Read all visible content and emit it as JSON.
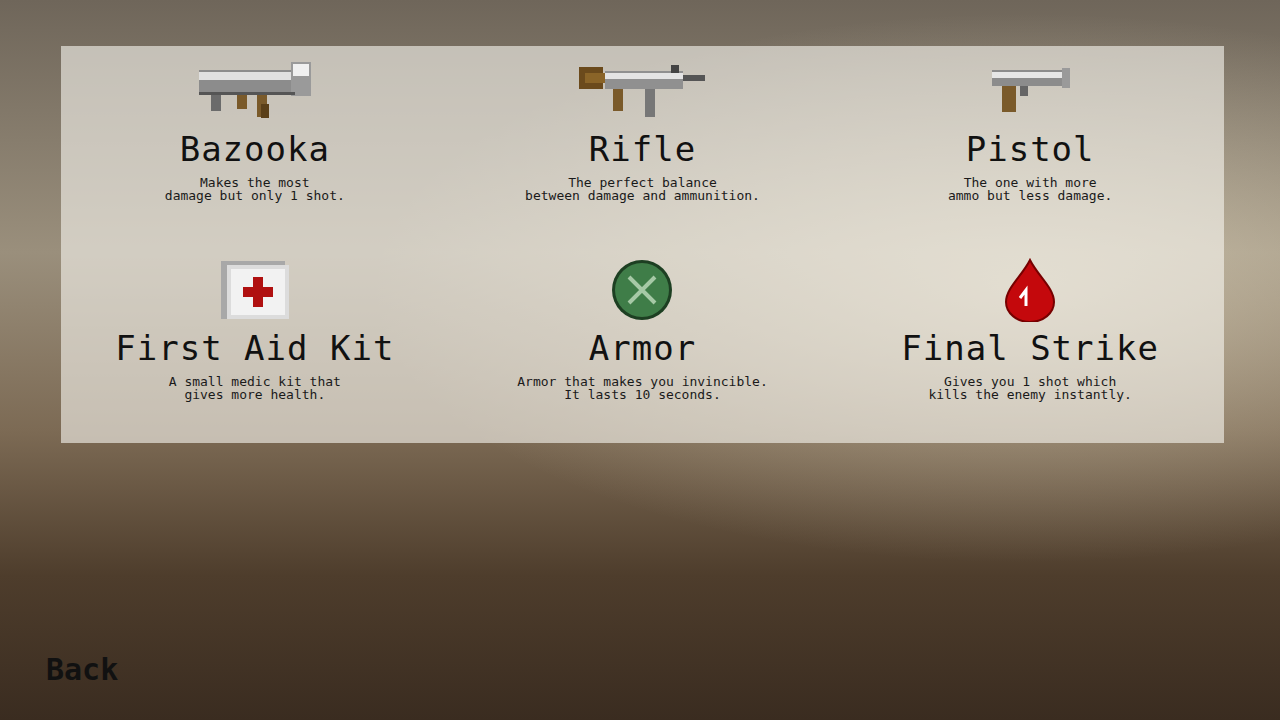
{
  "items": [
    {
      "title": "Bazooka",
      "lines": [
        "Makes the most",
        "damage but only 1 shot."
      ]
    },
    {
      "title": "Rifle",
      "lines": [
        "The perfect balance",
        "between damage and ammunition."
      ]
    },
    {
      "title": "Pistol",
      "lines": [
        "The one with more",
        "ammo but less damage."
      ]
    },
    {
      "title": "First Aid Kit",
      "lines": [
        "A small medic kit that",
        "gives more health."
      ]
    },
    {
      "title": "Armor",
      "lines": [
        "Armor that makes you  invincible.",
        "It lasts 10 seconds."
      ]
    },
    {
      "title": "Final Strike",
      "lines": [
        "Gives you 1 shot which",
        "kills the enemy instantly."
      ]
    }
  ],
  "back": "Back"
}
